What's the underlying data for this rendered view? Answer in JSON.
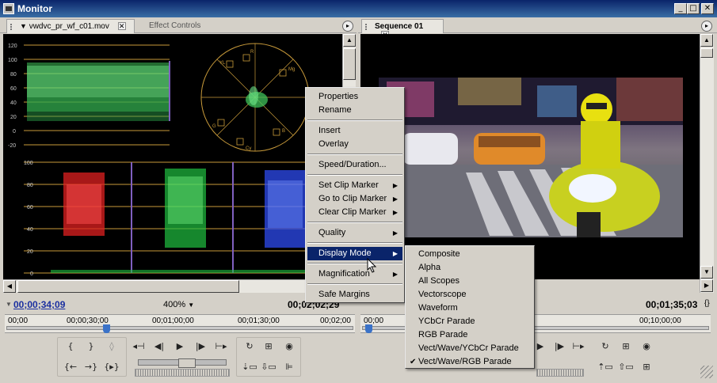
{
  "window": {
    "title": "Monitor"
  },
  "source_panel": {
    "tabs": [
      {
        "label": "vwdvc_pr_wf_c01.mov",
        "active": true
      },
      {
        "label": "Effect Controls",
        "active": false
      }
    ],
    "waveform_scale": [
      "120",
      "100",
      "80",
      "60",
      "40",
      "20",
      "0",
      "-20"
    ],
    "parade_scale": [
      "100",
      "80",
      "60",
      "40",
      "20",
      "0"
    ],
    "vectorscope_labels": [
      "R",
      "Mg",
      "B",
      "Cy",
      "G",
      "YL"
    ],
    "timecode_current": "00;00;34;09",
    "zoom": "400%",
    "timecode_duration": "00;02;02;29",
    "ruler_labels": [
      "00;00",
      "00;00;30;00",
      "00;01;00;00",
      "00;01;30;00",
      "00;02;00"
    ]
  },
  "program_panel": {
    "tabs": [
      {
        "label": "Sequence 01",
        "active": true
      }
    ],
    "timecode_duration": "00;01;35;03",
    "ruler_labels": [
      "00;00",
      "00;10;00;00"
    ]
  },
  "context_menu": {
    "items": [
      {
        "label": "Properties",
        "submenu": false
      },
      {
        "label": "Rename",
        "submenu": false
      },
      {
        "label": "Insert",
        "submenu": false
      },
      {
        "label": "Overlay",
        "submenu": false
      },
      {
        "label": "Speed/Duration...",
        "submenu": false
      },
      {
        "label": "Set Clip Marker",
        "submenu": true
      },
      {
        "label": "Go to Clip Marker",
        "submenu": true
      },
      {
        "label": "Clear Clip Marker",
        "submenu": true
      },
      {
        "label": "Quality",
        "submenu": true
      },
      {
        "label": "Display Mode",
        "submenu": true,
        "highlighted": true
      },
      {
        "label": "Magnification",
        "submenu": true
      },
      {
        "label": "Safe Margins",
        "submenu": false
      }
    ]
  },
  "display_mode_submenu": {
    "items": [
      {
        "label": "Composite",
        "checked": false
      },
      {
        "label": "Alpha",
        "checked": false
      },
      {
        "label": "All Scopes",
        "checked": false
      },
      {
        "label": "Vectorscope",
        "checked": false
      },
      {
        "label": "Waveform",
        "checked": false
      },
      {
        "label": "YCbCr Parade",
        "checked": false
      },
      {
        "label": "RGB Parade",
        "checked": false
      },
      {
        "label": "Vect/Wave/YCbCr Parade",
        "checked": false
      },
      {
        "label": "Vect/Wave/RGB Parade",
        "checked": true
      }
    ]
  },
  "colors": {
    "title_bar": "#0a246a",
    "menu_highlight": "#0a246a",
    "waveform": "#3fc25a",
    "scope_lines": "#c89a3a",
    "parade_red": "#e02020",
    "parade_green": "#20c040",
    "parade_blue": "#3050ff",
    "timecode_blue": "#1a2fa0"
  }
}
